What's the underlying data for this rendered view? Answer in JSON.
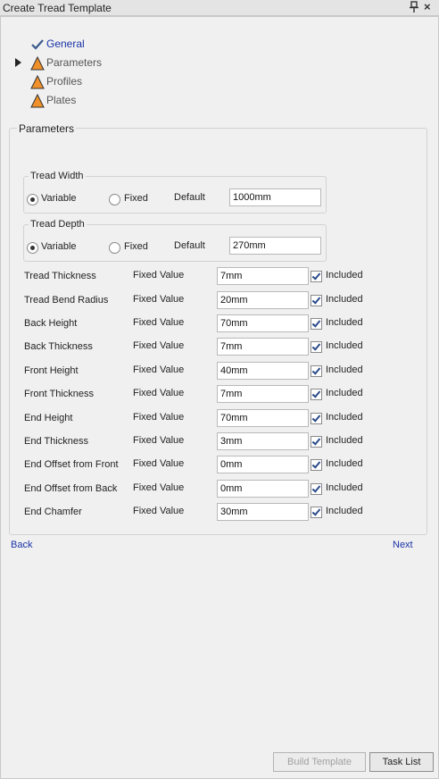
{
  "window": {
    "title": "Create Tread Template"
  },
  "steps": [
    {
      "label": "General",
      "state": "done"
    },
    {
      "label": "Parameters",
      "state": "warning"
    },
    {
      "label": "Profiles",
      "state": "warning"
    },
    {
      "label": "Plates",
      "state": "warning"
    }
  ],
  "parameters": {
    "title": "Parameters",
    "tread_width": {
      "title": "Tread Width",
      "variable_label": "Variable",
      "fixed_label": "Fixed",
      "default_label": "Default",
      "value": "1000mm",
      "selected": "Variable"
    },
    "tread_depth": {
      "title": "Tread Depth",
      "variable_label": "Variable",
      "fixed_label": "Fixed",
      "default_label": "Default",
      "value": "270mm",
      "selected": "Variable"
    },
    "rows": [
      {
        "label": "Tread Thickness",
        "mode": "Fixed Value",
        "value": "7mm",
        "included": "Included"
      },
      {
        "label": "Tread Bend Radius",
        "mode": "Fixed Value",
        "value": "20mm",
        "included": "Included"
      },
      {
        "label": "Back Height",
        "mode": "Fixed Value",
        "value": "70mm",
        "included": "Included"
      },
      {
        "label": "Back Thickness",
        "mode": "Fixed Value",
        "value": "7mm",
        "included": "Included"
      },
      {
        "label": "Front Height",
        "mode": "Fixed Value",
        "value": "40mm",
        "included": "Included"
      },
      {
        "label": "Front Thickness",
        "mode": "Fixed Value",
        "value": "7mm",
        "included": "Included"
      },
      {
        "label": "End Height",
        "mode": "Fixed Value",
        "value": "70mm",
        "included": "Included"
      },
      {
        "label": "End Thickness",
        "mode": "Fixed Value",
        "value": "3mm",
        "included": "Included"
      },
      {
        "label": "End Offset from Front",
        "mode": "Fixed Value",
        "value": "0mm",
        "included": "Included"
      },
      {
        "label": "End Offset from Back",
        "mode": "Fixed Value",
        "value": "0mm",
        "included": "Included"
      },
      {
        "label": "End Chamfer",
        "mode": "Fixed Value",
        "value": "30mm",
        "included": "Included"
      }
    ]
  },
  "nav": {
    "back": "Back",
    "next": "Next"
  },
  "buttons": {
    "build": "Build Template",
    "task_list": "Task List"
  }
}
